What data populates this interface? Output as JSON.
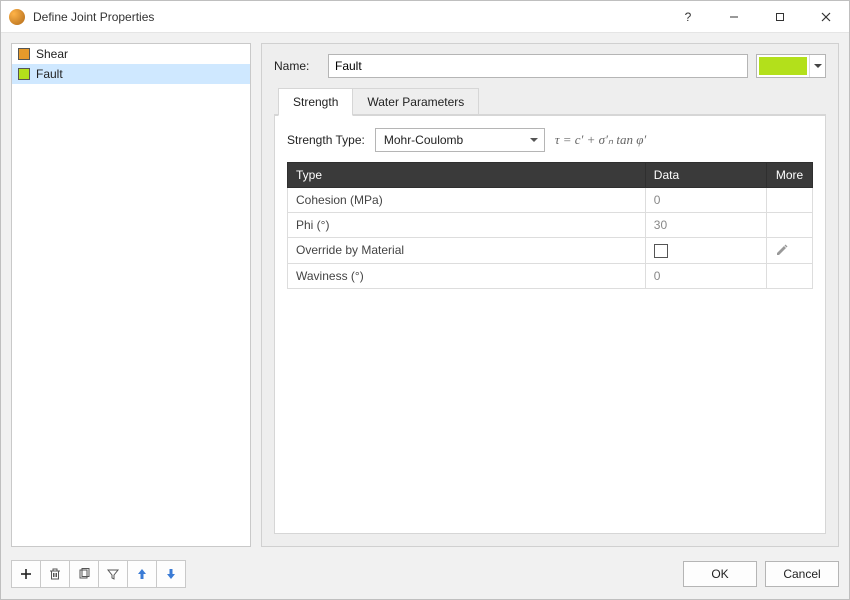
{
  "window": {
    "title": "Define Joint Properties"
  },
  "sidebar": {
    "items": [
      {
        "label": "Shear",
        "color": "#E69A2B",
        "selected": false
      },
      {
        "label": "Fault",
        "color": "#B3E01B",
        "selected": true
      }
    ]
  },
  "main": {
    "name_label": "Name:",
    "name_value": "Fault",
    "color_value": "#B3E01B",
    "tabs": [
      {
        "id": "strength",
        "label": "Strength",
        "active": true
      },
      {
        "id": "water",
        "label": "Water Parameters",
        "active": false
      }
    ],
    "strength": {
      "type_label": "Strength Type:",
      "type_value": "Mohr-Coulomb",
      "formula": "τ = c′ + σ′ₙ tan φ′",
      "columns": {
        "type": "Type",
        "data": "Data",
        "more": "More"
      },
      "rows": [
        {
          "type": "Cohesion (MPa)",
          "data": "0",
          "more": ""
        },
        {
          "type": "Phi (°)",
          "data": "30",
          "more": ""
        },
        {
          "type": "Override by Material",
          "data_kind": "checkbox",
          "data": "",
          "more": "edit"
        },
        {
          "type": "Waviness (°)",
          "data": "0",
          "more": ""
        }
      ]
    }
  },
  "footer": {
    "ok": "OK",
    "cancel": "Cancel"
  }
}
